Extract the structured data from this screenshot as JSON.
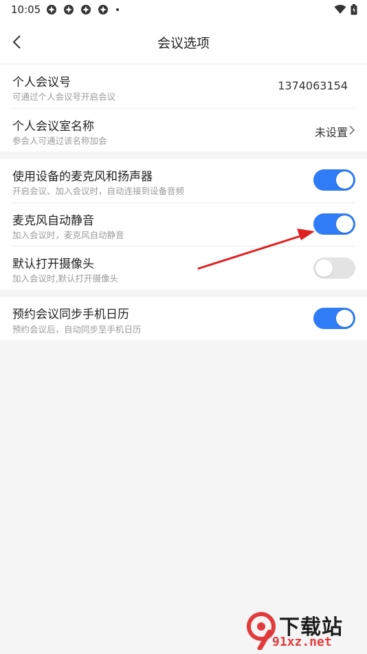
{
  "status_bar": {
    "time": "10:05"
  },
  "header": {
    "title": "会议选项"
  },
  "personal": {
    "meeting_id": {
      "label": "个人会议号",
      "desc": "可通过个人会议号开启会议",
      "value": "1374063154"
    },
    "room_name": {
      "label": "个人会议室名称",
      "desc": "参会人可通过该名称加会",
      "value": "未设置"
    }
  },
  "audio": {
    "use_device": {
      "label": "使用设备的麦克风和扬声器",
      "desc": "开启会议、加入会议时，自动连接到设备音频",
      "on": true
    },
    "auto_mute": {
      "label": "麦克风自动静音",
      "desc": "加入会议时，麦克风自动静音",
      "on": true
    },
    "camera": {
      "label": "默认打开摄像头",
      "desc": "加入会议时,默认打开摄像头",
      "on": false
    }
  },
  "calendar": {
    "sync": {
      "label": "预约会议同步手机日历",
      "desc": "预约会议后，自动同步至手机日历",
      "on": true
    }
  },
  "watermark": {
    "brand": "下载站",
    "url": "91xz.net"
  },
  "colors": {
    "accent": "#2f7cf6",
    "annotation_arrow": "#e02020"
  }
}
